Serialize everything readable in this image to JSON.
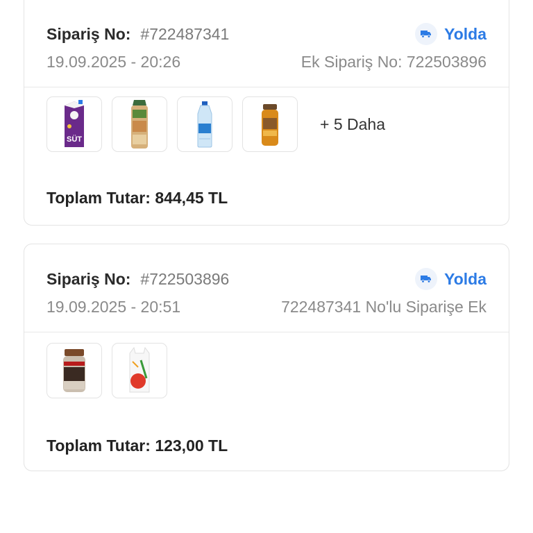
{
  "orders": [
    {
      "order_label": "Sipariş No:",
      "order_number": "#722487341",
      "status": "Yolda",
      "date": "19.09.2025 - 20:26",
      "extra_info": "Ek Sipariş No: 722503896",
      "products": [
        {
          "name": "milk-carton",
          "text": "SÜT"
        },
        {
          "name": "bread-loaf"
        },
        {
          "name": "water-bottle"
        },
        {
          "name": "honey-jar"
        }
      ],
      "more_text": "+ 5 Daha",
      "total_label": "Toplam Tutar:",
      "total_value": "844,45 TL"
    },
    {
      "order_label": "Sipariş No:",
      "order_number": "#722503896",
      "status": "Yolda",
      "date": "19.09.2025 - 20:51",
      "extra_info": "722487341 No'lu Siparişe Ek",
      "products": [
        {
          "name": "tahini-jar"
        },
        {
          "name": "shopping-bag"
        }
      ],
      "more_text": "",
      "total_label": "Toplam Tutar:",
      "total_value": "123,00 TL"
    }
  ],
  "colors": {
    "accent": "#2c7be5",
    "muted": "#8a8a8a",
    "border": "#e3e3e3"
  }
}
